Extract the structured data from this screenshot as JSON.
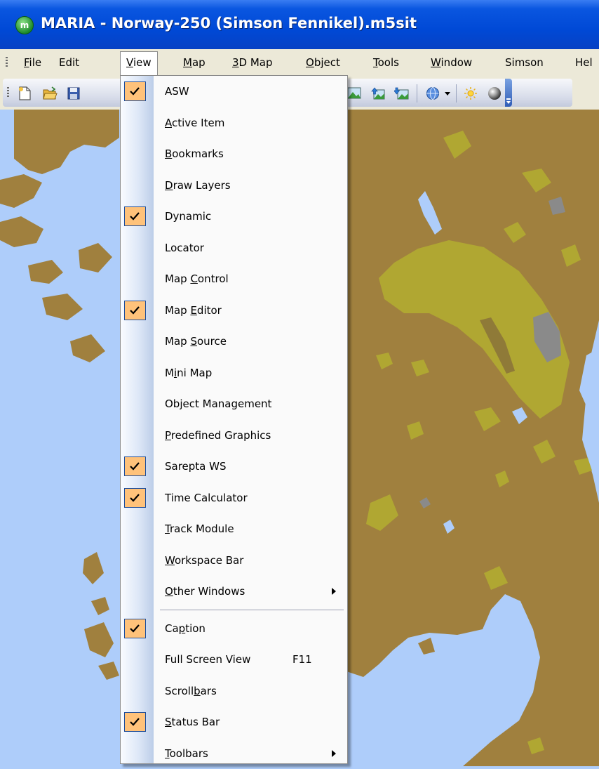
{
  "window": {
    "title": "MARIA - Norway-250 (Simson Fennikel).m5sit",
    "icon": "maria-app-icon"
  },
  "menubar": {
    "items": [
      {
        "label": "File",
        "ul": "F",
        "rest": "ile",
        "active": false
      },
      {
        "label": "Edit",
        "ul": "",
        "rest": "Edit",
        "active": false
      },
      {
        "label": "View",
        "ul": "V",
        "rest": "iew",
        "active": true
      },
      {
        "label": "Map",
        "ul": "M",
        "rest": "ap",
        "active": false
      },
      {
        "label": "3D Map",
        "ul": "3",
        "rest": "D Map",
        "active": false
      },
      {
        "label": "Object",
        "ul": "O",
        "rest": "bject",
        "active": false
      },
      {
        "label": "Tools",
        "ul": "T",
        "rest": "ools",
        "active": false
      },
      {
        "label": "Window",
        "ul": "W",
        "rest": "indow",
        "active": false
      },
      {
        "label": "Simson",
        "ul": "",
        "rest": "Simson",
        "active": false
      },
      {
        "label": "Help",
        "ul": "",
        "rest": "Hel",
        "active": false
      }
    ]
  },
  "toolbar": {
    "icons": [
      "new-file-icon",
      "open-folder-icon",
      "save-icon",
      "map-layer-icon",
      "map-import-icon",
      "map-export-icon",
      "globe-icon",
      "dropdown-arrow-icon",
      "sun-icon",
      "sphere-icon",
      "toolbar-overflow-icon"
    ]
  },
  "view_menu": {
    "items": [
      {
        "label": "ASW",
        "pre": "ASW",
        "ul": "",
        "post": "",
        "checked": true
      },
      {
        "label": "Active Item",
        "pre": "",
        "ul": "A",
        "post": "ctive Item",
        "checked": false
      },
      {
        "label": "Bookmarks",
        "pre": "",
        "ul": "B",
        "post": "ookmarks",
        "checked": false
      },
      {
        "label": "Draw Layers",
        "pre": "",
        "ul": "D",
        "post": "raw Layers",
        "checked": false
      },
      {
        "label": "Dynamic",
        "pre": "Dynamic",
        "ul": "",
        "post": "",
        "checked": true
      },
      {
        "label": "Locator",
        "pre": "Locator",
        "ul": "",
        "post": "",
        "checked": false
      },
      {
        "label": "Map Control",
        "pre": "Map ",
        "ul": "C",
        "post": "ontrol",
        "checked": false
      },
      {
        "label": "Map Editor",
        "pre": "Map ",
        "ul": "E",
        "post": "ditor",
        "checked": true
      },
      {
        "label": "Map Source",
        "pre": "Map ",
        "ul": "S",
        "post": "ource",
        "checked": false
      },
      {
        "label": "Mini Map",
        "pre": "M",
        "ul": "i",
        "post": "ni Map",
        "checked": false
      },
      {
        "label": "Object Management",
        "pre": "Object Management",
        "ul": "",
        "post": "",
        "checked": false
      },
      {
        "label": "Predefined Graphics",
        "pre": "",
        "ul": "P",
        "post": "redefined Graphics",
        "checked": false
      },
      {
        "label": "Sarepta WS",
        "pre": "Sarepta WS",
        "ul": "",
        "post": "",
        "checked": true
      },
      {
        "label": "Time Calculator",
        "pre": "Time Calculator",
        "ul": "",
        "post": "",
        "checked": true
      },
      {
        "label": "Track Module",
        "pre": "",
        "ul": "T",
        "post": "rack Module",
        "checked": false
      },
      {
        "label": "Workspace Bar",
        "pre": "",
        "ul": "W",
        "post": "orkspace Bar",
        "checked": false
      },
      {
        "label": "Other Windows",
        "pre": "",
        "ul": "O",
        "post": "ther Windows",
        "checked": false,
        "submenu": true
      },
      {
        "label": "Caption",
        "pre": "Ca",
        "ul": "p",
        "post": "tion",
        "checked": true,
        "sep_before": true
      },
      {
        "label": "Full Screen View",
        "pre": "Full Screen View",
        "ul": "",
        "post": "",
        "checked": false,
        "shortcut": "F11"
      },
      {
        "label": "Scrollbars",
        "pre": "Scroll",
        "ul": "b",
        "post": "ars",
        "checked": false
      },
      {
        "label": "Status Bar",
        "pre": "",
        "ul": "S",
        "post": "tatus Bar",
        "checked": true
      },
      {
        "label": "Toolbars",
        "pre": "",
        "ul": "T",
        "post": "oolbars",
        "checked": false,
        "submenu": true
      }
    ]
  },
  "colors": {
    "titlebar": "#0049d6",
    "menubar": "#ece9d8",
    "water": "#aecdfa",
    "land": "#a0803e",
    "vegetation": "#b0a732",
    "urban": "#8a8a8a",
    "check_bg": "#ffc27a",
    "check_border": "#1f4e9a"
  }
}
